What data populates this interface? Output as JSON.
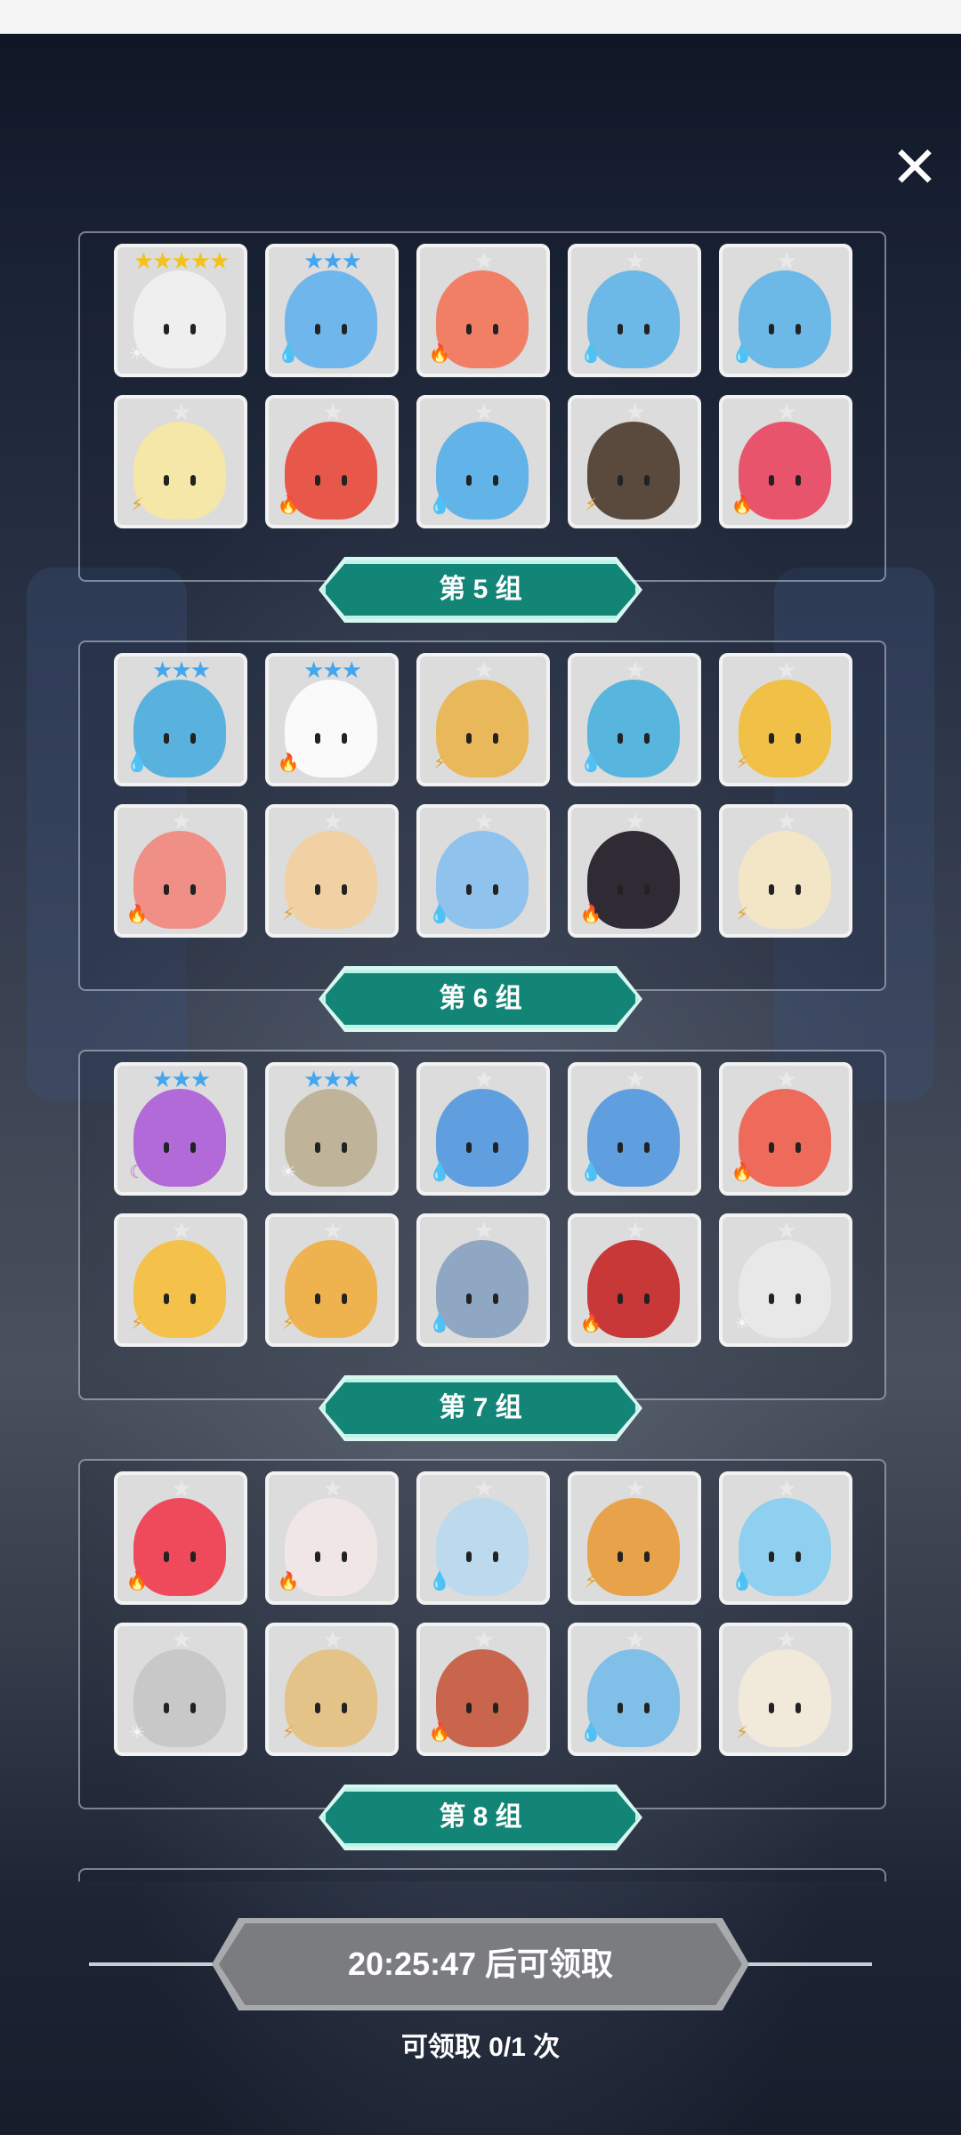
{
  "close_icon": "close-icon",
  "colors": {
    "water": "#2f7fe0",
    "fire": "#e0482f",
    "thunder": "#e6a321",
    "light": "#f5f5f5",
    "moon": "#c06ad0",
    "group_label": "#138577"
  },
  "groups": [
    {
      "label": "第 5 组",
      "cards": [
        {
          "stars": "★★★★★",
          "star_color": "#f3c21b",
          "element": "light",
          "color": "#efefef"
        },
        {
          "stars": "★★★",
          "star_color": "#43a6ef",
          "element": "water",
          "color": "#6fb6ec"
        },
        {
          "stars": "★",
          "star_color": "#e9e9e9",
          "element": "fire",
          "color": "#f07f66"
        },
        {
          "stars": "★",
          "star_color": "#e9e9e9",
          "element": "water",
          "color": "#6cb8e6"
        },
        {
          "stars": "★",
          "star_color": "#e9e9e9",
          "element": "water",
          "color": "#6cb8e6"
        },
        {
          "stars": "★",
          "star_color": "#e9e9e9",
          "element": "thunder",
          "color": "#f4e7a7"
        },
        {
          "stars": "★",
          "star_color": "#e9e9e9",
          "element": "fire",
          "color": "#e7574a"
        },
        {
          "stars": "★",
          "star_color": "#e9e9e9",
          "element": "water",
          "color": "#61b3e8"
        },
        {
          "stars": "★",
          "star_color": "#e9e9e9",
          "element": "thunder",
          "color": "#5a4a3d"
        },
        {
          "stars": "★",
          "star_color": "#e9e9e9",
          "element": "fire",
          "color": "#e8546b"
        }
      ]
    },
    {
      "label": "第 6 组",
      "cards": [
        {
          "stars": "★★★",
          "star_color": "#43a6ef",
          "element": "water",
          "color": "#59b2dd"
        },
        {
          "stars": "★★★",
          "star_color": "#43a6ef",
          "element": "fire",
          "color": "#fafafa"
        },
        {
          "stars": "★",
          "star_color": "#e9e9e9",
          "element": "thunder",
          "color": "#e9b85a"
        },
        {
          "stars": "★",
          "star_color": "#e9e9e9",
          "element": "water",
          "color": "#57b5de"
        },
        {
          "stars": "★",
          "star_color": "#e9e9e9",
          "element": "thunder",
          "color": "#f0c047"
        },
        {
          "stars": "★",
          "star_color": "#e9e9e9",
          "element": "fire",
          "color": "#ef8f86"
        },
        {
          "stars": "★",
          "star_color": "#e9e9e9",
          "element": "thunder",
          "color": "#f1d0a3"
        },
        {
          "stars": "★",
          "star_color": "#e9e9e9",
          "element": "water",
          "color": "#8fc2ec"
        },
        {
          "stars": "★",
          "star_color": "#e9e9e9",
          "element": "fire",
          "color": "#2f2a33"
        },
        {
          "stars": "★",
          "star_color": "#e9e9e9",
          "element": "thunder",
          "color": "#f2e6c7"
        }
      ]
    },
    {
      "label": "第 7 组",
      "cards": [
        {
          "stars": "★★★",
          "star_color": "#43a6ef",
          "element": "moon",
          "color": "#b36ad9"
        },
        {
          "stars": "★★★",
          "star_color": "#43a6ef",
          "element": "light",
          "color": "#bfb39a"
        },
        {
          "stars": "★",
          "star_color": "#e9e9e9",
          "element": "water",
          "color": "#5f9fe0"
        },
        {
          "stars": "★",
          "star_color": "#e9e9e9",
          "element": "water",
          "color": "#5f9fe0"
        },
        {
          "stars": "★",
          "star_color": "#e9e9e9",
          "element": "fire",
          "color": "#ee6b5c"
        },
        {
          "stars": "★",
          "star_color": "#e9e9e9",
          "element": "thunder",
          "color": "#f4c24a"
        },
        {
          "stars": "★",
          "star_color": "#e9e9e9",
          "element": "thunder",
          "color": "#eeb24f"
        },
        {
          "stars": "★",
          "star_color": "#e9e9e9",
          "element": "water",
          "color": "#8fa7c2"
        },
        {
          "stars": "★",
          "star_color": "#e9e9e9",
          "element": "fire",
          "color": "#c83838"
        },
        {
          "stars": "★",
          "star_color": "#e9e9e9",
          "element": "light",
          "color": "#e8e8e8"
        }
      ]
    },
    {
      "label": "第 8 组",
      "cards": [
        {
          "stars": "★",
          "star_color": "#e9e9e9",
          "element": "fire",
          "color": "#ee4a5c"
        },
        {
          "stars": "★",
          "star_color": "#e9e9e9",
          "element": "fire",
          "color": "#f0e6e6"
        },
        {
          "stars": "★",
          "star_color": "#e9e9e9",
          "element": "water",
          "color": "#bcd9ee"
        },
        {
          "stars": "★",
          "star_color": "#e9e9e9",
          "element": "thunder",
          "color": "#e7a24a"
        },
        {
          "stars": "★",
          "star_color": "#e9e9e9",
          "element": "water",
          "color": "#8fd0f0"
        },
        {
          "stars": "★",
          "star_color": "#e9e9e9",
          "element": "light",
          "color": "#c8c8c8"
        },
        {
          "stars": "★",
          "star_color": "#e9e9e9",
          "element": "thunder",
          "color": "#e3c388"
        },
        {
          "stars": "★",
          "star_color": "#e9e9e9",
          "element": "fire",
          "color": "#c9654d"
        },
        {
          "stars": "★",
          "star_color": "#e9e9e9",
          "element": "water",
          "color": "#7fbfe8"
        },
        {
          "stars": "★",
          "star_color": "#e9e9e9",
          "element": "thunder",
          "color": "#f1eadb"
        }
      ]
    }
  ],
  "element_glyphs": {
    "water": "💧",
    "fire": "🔥",
    "thunder": "⚡",
    "light": "☀",
    "moon": "☾"
  },
  "timer_text": "20:25:47 后可领取",
  "claim_count": "可领取 0/1 次"
}
